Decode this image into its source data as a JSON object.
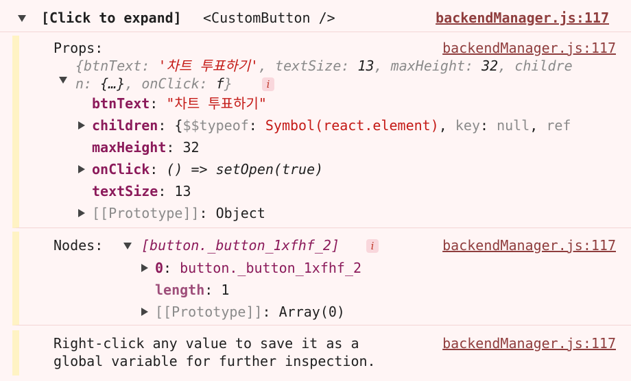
{
  "header": {
    "title": "[Click to expand]",
    "component": "<CustomButton />",
    "source": "backendManager.js:117"
  },
  "props": {
    "label": "Props:",
    "source": "backendManager.js:117",
    "summary_line1": {
      "open": "{",
      "k1": "btnText",
      "v1": "'차트 투표하기'",
      "k2": "textSize",
      "v2": "13",
      "k3": "maxHeight",
      "v3": "32",
      "k4a": "childre"
    },
    "summary_line2": {
      "k4b": "n",
      "v4": "{…}",
      "k5": "onClick",
      "v5": "f",
      "close": "}"
    },
    "info_icon": "i",
    "items": {
      "btnText": {
        "key": "btnText",
        "value": "\"차트 투표하기\""
      },
      "children": {
        "key": "children",
        "open": "{",
        "k1": "$$typeof",
        "v1": "Symbol(react.element)",
        "k2": "key",
        "v2": "null",
        "k3": "ref"
      },
      "maxHeight": {
        "key": "maxHeight",
        "value": "32"
      },
      "onClick": {
        "key": "onClick",
        "value": "() => setOpen(true)"
      },
      "textSize": {
        "key": "textSize",
        "value": "13"
      },
      "prototype": {
        "key": "[[Prototype]]",
        "value": "Object"
      }
    }
  },
  "nodes": {
    "label": "Nodes:",
    "summary": "[button._button_1xfhf_2]",
    "info_icon": "i",
    "source": "backendManager.js:117",
    "items": {
      "zero": {
        "key": "0",
        "value": "button._button_1xfhf_2"
      },
      "length": {
        "key": "length",
        "value": "1"
      },
      "prototype": {
        "key": "[[Prototype]]",
        "value": "Array(0)"
      }
    }
  },
  "footer": {
    "line1": "Right-click any value to save it as a",
    "line2": "global variable for further inspection.",
    "source": "backendManager.js:117"
  },
  "colors": {
    "background": "#fff5f5",
    "group_bar": "#fff3c4",
    "key": "#8b1a5a",
    "string": "#c41a16",
    "link": "#8f3d3d"
  }
}
